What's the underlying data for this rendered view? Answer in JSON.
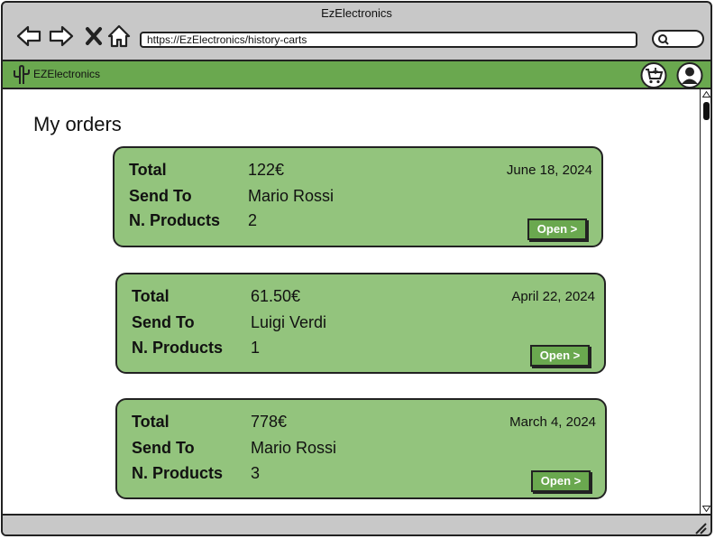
{
  "window": {
    "title": "EzElectronics"
  },
  "browser": {
    "url": "https://EzElectronics/history-carts",
    "icons": [
      "back-icon",
      "forward-icon",
      "close-icon",
      "home-icon",
      "search-icon"
    ]
  },
  "appbar": {
    "brand": "EZElectronics",
    "icons": [
      "cactus-logo-icon",
      "cart-icon",
      "user-icon"
    ],
    "accent": "#6aa84f"
  },
  "page": {
    "title": "My orders"
  },
  "labels": {
    "total": "Total",
    "send_to": "Send To",
    "n_products": "N. Products",
    "open": "Open >"
  },
  "orders": [
    {
      "total": "122€",
      "send_to": "Mario Rossi",
      "n_products": "2",
      "date": "June 18, 2024"
    },
    {
      "total": "61.50€",
      "send_to": "Luigi Verdi",
      "n_products": "1",
      "date": "April 22, 2024"
    },
    {
      "total": "778€",
      "send_to": "Mario Rossi",
      "n_products": "3",
      "date": "March 4, 2024"
    }
  ],
  "colors": {
    "card": "#93c47d",
    "button": "#6aa84f"
  }
}
